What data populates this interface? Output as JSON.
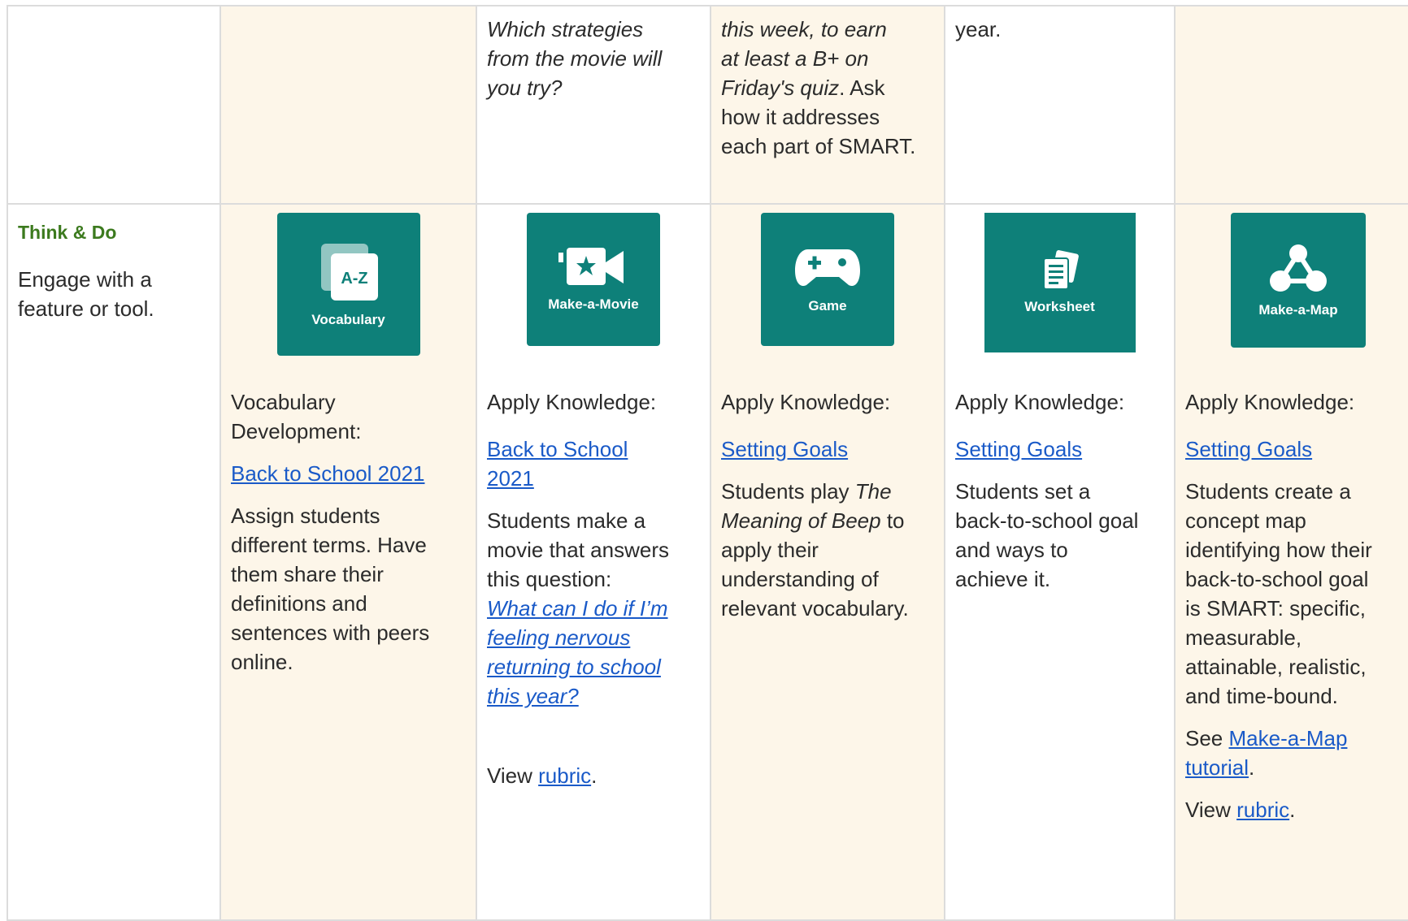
{
  "top_row": {
    "col3": [
      "Which strategies",
      "from the movie will",
      "you try?"
    ],
    "col4_italic": [
      "this week, to earn",
      "at least a B+ on",
      "Friday's quiz"
    ],
    "col4_rest_a": ". Ask",
    "col4_rest_lines": [
      "how it addresses",
      "each part of SMART."
    ],
    "col5": "year."
  },
  "think_do": {
    "title": "Think & Do",
    "desc_lines": [
      "Engage with a",
      "feature or tool."
    ]
  },
  "cells": [
    {
      "tile_label": "Vocabulary",
      "tile_icon": "vocabulary-icon",
      "heading_lines": [
        "Vocabulary",
        "Development:"
      ],
      "link": "Back to School 2021",
      "body_lines": [
        "Assign students",
        "different terms. Have",
        "them share their",
        "definitions and",
        "sentences with peers",
        "online."
      ]
    },
    {
      "tile_label": "Make-a-Movie",
      "tile_icon": "movie-camera-icon",
      "heading": "Apply Knowledge:",
      "link_lines": [
        "Back to School",
        "2021"
      ],
      "body_lines": [
        "Students make a",
        "movie that answers",
        "this question:"
      ],
      "question_lines": [
        "What can I do if I’m",
        "feeling nervous",
        "returning to school",
        "this year?"
      ],
      "view_prefix": "View ",
      "view_link": "rubric",
      "view_suffix": "."
    },
    {
      "tile_label": "Game",
      "tile_icon": "gamepad-icon",
      "heading": "Apply Knowledge:",
      "link": "Setting Goals",
      "body_a": "Students play ",
      "body_italic": "The Meaning of Beep",
      "body_b": " to apply their understanding of relevant vocabulary."
    },
    {
      "tile_label": "Worksheet",
      "tile_icon": "worksheet-icon",
      "heading": "Apply Knowledge:",
      "link": "Setting Goals",
      "body_lines": [
        "Students set a",
        "back-to-school goal",
        "and ways to",
        "achieve it."
      ]
    },
    {
      "tile_label": "Make-a-Map",
      "tile_icon": "concept-map-icon",
      "heading": "Apply Knowledge:",
      "link": "Setting Goals",
      "body_lines": [
        "Students create a",
        "concept map",
        "identifying how their",
        "back-to-school goal",
        "is SMART: specific,",
        "measurable,",
        "attainable, realistic,",
        "and time-bound."
      ],
      "see_prefix": "See ",
      "see_link_lines": [
        "Make-a-Map",
        "tutorial"
      ],
      "see_suffix": ".",
      "view_prefix": "View ",
      "view_link": "rubric",
      "view_suffix": "."
    }
  ],
  "colors": {
    "tile": "#0e8079",
    "cream": "#fdf6e9",
    "link": "#1a5ac8",
    "label_green": "#3c7a1e"
  }
}
